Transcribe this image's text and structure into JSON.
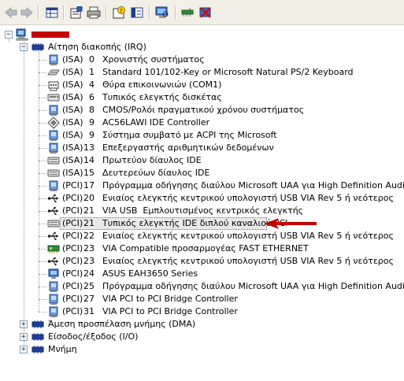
{
  "toolbar": {
    "buttons": [
      "back-arrow-icon",
      "forward-arrow-icon",
      "properties-grid-icon",
      "update-driver-icon",
      "print-icon",
      "help-icon",
      "show-hidden-icon",
      "scan-hardware-icon",
      "disable-device-icon",
      "uninstall-device-icon"
    ]
  },
  "tree": {
    "root_expander": "−",
    "category_expanded": "−",
    "category_collapsed": "+",
    "irq": {
      "label": "Αίτηση διακοπής (IRQ)",
      "items": [
        {
          "bus": "(ISA)",
          "irq": "0",
          "name": "Χρονιστής συστήματος",
          "icon": "system-device-icon"
        },
        {
          "bus": "(ISA)",
          "irq": "1",
          "name": "Standard 101/102-Key or Microsoft Natural PS/2 Keyboard",
          "icon": "keyboard-icon"
        },
        {
          "bus": "(ISA)",
          "irq": "4",
          "name": "Θύρα επικοινωνιών (COM1)",
          "icon": "port-icon"
        },
        {
          "bus": "(ISA)",
          "irq": "6",
          "name": "Τυπικός ελεγκτής δισκέτας",
          "icon": "floppy-controller-icon"
        },
        {
          "bus": "(ISA)",
          "irq": "8",
          "name": "CMOS/Ρολόι πραγματικού χρόνου συστήματος",
          "icon": "system-device-icon"
        },
        {
          "bus": "(ISA)",
          "irq": "9",
          "name": "AC56LAWI IDE Controller",
          "icon": "network-diamond-icon"
        },
        {
          "bus": "(ISA)",
          "irq": "9",
          "name": "Σύστημα συμβατό με ACPI της Microsoft",
          "icon": "system-device-icon"
        },
        {
          "bus": "(ISA)",
          "irq": "13",
          "name": "Επεξεργαστής αριθμητικών δεδομένων",
          "icon": "system-device-icon"
        },
        {
          "bus": "(ISA)",
          "irq": "14",
          "name": "Πρωτεύον δίαυλος IDE",
          "icon": "ide-channel-icon"
        },
        {
          "bus": "(ISA)",
          "irq": "15",
          "name": "Δευτερεύων δίαυλος IDE",
          "icon": "ide-channel-icon"
        },
        {
          "bus": "(PCI)",
          "irq": "17",
          "name": "Πρόγραμμα οδήγησης διαύλου Microsoft UAA για High Definition Audio",
          "icon": "system-device-icon"
        },
        {
          "bus": "(PCI)",
          "irq": "20",
          "name": "Ενιαίος ελεγκτής κεντρικού υπολογιστή USB VIA Rev 5 ή νεότερος",
          "icon": "usb-icon"
        },
        {
          "bus": "(PCI)",
          "irq": "21",
          "name": "VIA USB  Εμπλουτισμένος κεντρικός ελεγκτής",
          "icon": "usb-icon"
        },
        {
          "bus": "(PCI)",
          "irq": "21",
          "name": "Τυπικός ελεγκτής IDE διπλού καναλιού PCI",
          "icon": "ide-channel-icon",
          "selected": true
        },
        {
          "bus": "(PCI)",
          "irq": "22",
          "name": "Ενιαίος ελεγκτής κεντρικού υπολογιστή USB VIA Rev 5 ή νεότερος",
          "icon": "usb-icon"
        },
        {
          "bus": "(PCI)",
          "irq": "23",
          "name": "VIA Compatible προσαρμογέας FAST ETHERNET",
          "icon": "network-card-icon"
        },
        {
          "bus": "(PCI)",
          "irq": "23",
          "name": "Ενιαίος ελεγκτής κεντρικού υπολογιστή USB VIA Rev 5 ή νεότερος",
          "icon": "usb-icon"
        },
        {
          "bus": "(PCI)",
          "irq": "24",
          "name": "ASUS EAH3650 Series",
          "icon": "display-adapter-icon"
        },
        {
          "bus": "(PCI)",
          "irq": "25",
          "name": "Πρόγραμμα οδήγησης διαύλου Microsoft UAA για High Definition Audio",
          "icon": "system-device-icon"
        },
        {
          "bus": "(PCI)",
          "irq": "27",
          "name": "VIA PCI to PCI Bridge Controller",
          "icon": "system-device-icon"
        },
        {
          "bus": "(PCI)",
          "irq": "31",
          "name": "VIA PCI to PCI Bridge Controller",
          "icon": "system-device-icon"
        }
      ]
    },
    "collapsed_categories": [
      {
        "label": "Άμεση προσπέλαση μνήμης (DMA)"
      },
      {
        "label": "Είσοδος/έξοδος (I/O)"
      },
      {
        "label": "Μνήμη"
      }
    ]
  },
  "colors": {
    "toolbar_bg": "#f1efe6",
    "annotation_arrow": "#c00000",
    "redaction": "#c50000",
    "selection_bg": "#e9e9e9"
  }
}
